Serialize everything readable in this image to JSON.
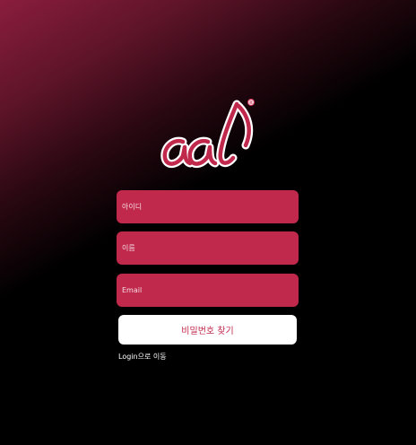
{
  "brand": {
    "logo_text": "aal",
    "logo_icon": "registered-mark-icon",
    "logo_color": "#c0294c"
  },
  "form": {
    "id_placeholder": "아이디",
    "name_placeholder": "이름",
    "email_placeholder": "Email",
    "submit_label": "비밀번호 찾기",
    "field_color": "#c0294c"
  },
  "footer": {
    "login_link": "Login으로 이동"
  }
}
